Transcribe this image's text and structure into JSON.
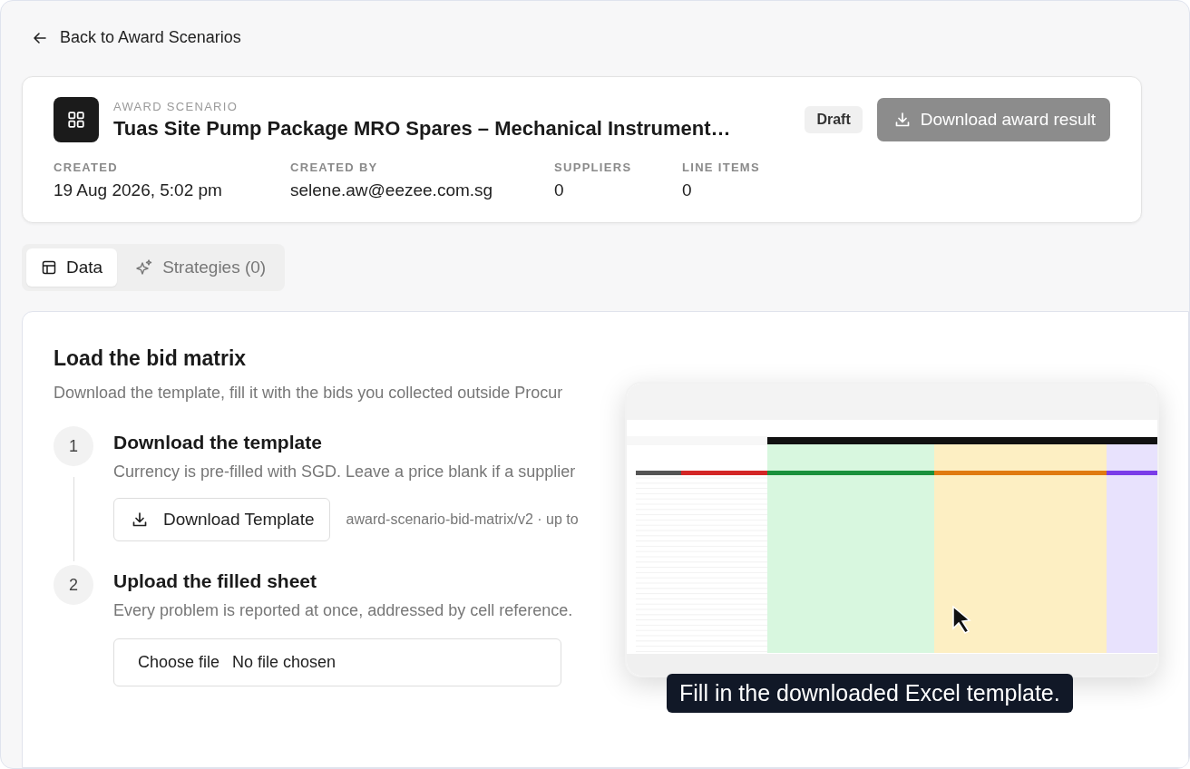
{
  "back_link": "Back to Award Scenarios",
  "scenario": {
    "eyebrow": "AWARD SCENARIO",
    "title": "Tuas Site Pump Package MRO Spares – Mechanical Instrument…",
    "status": "Draft",
    "action": {
      "label": "Download award result",
      "disabled": true
    },
    "meta": [
      {
        "label": "CREATED",
        "value": "19 Aug 2026, 5:02 pm"
      },
      {
        "label": "CREATED BY",
        "value": "selene.aw@eezee.com.sg"
      },
      {
        "label": "SUPPLIERS",
        "value": "0"
      },
      {
        "label": "LINE ITEMS",
        "value": "0"
      }
    ]
  },
  "tabs": [
    {
      "label": "Data",
      "kind": "table",
      "selected": true
    },
    {
      "label": "Strategies (0)",
      "kind": "sparkle",
      "selected": false
    }
  ],
  "panel": {
    "title": "Load the bid matrix",
    "description": "Download the template, fill it with the bids you collected outside Procur",
    "steps": [
      {
        "number": "1",
        "title": "Download the template",
        "description": "Currency is pre-filled with SGD. Leave a price blank if a supplier",
        "kind": "download",
        "button": "Download Template",
        "note": "award-scenario-bid-matrix/v2 · up to"
      },
      {
        "number": "2",
        "title": "Upload the filled sheet",
        "description": "Every problem is reported at once, addressed by cell reference.",
        "kind": "upload",
        "button": "Choose file",
        "note": "No file chosen"
      }
    ]
  },
  "preview": {
    "kind": "picture",
    "caption": "Fill in the downloaded Excel template."
  }
}
